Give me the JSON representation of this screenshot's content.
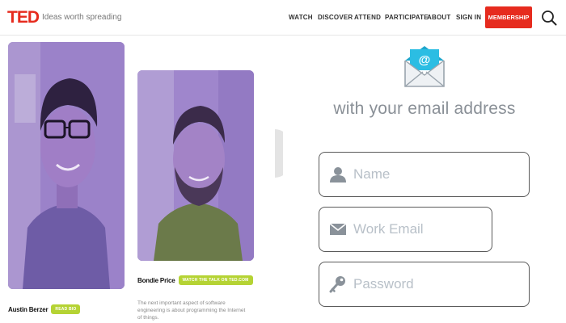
{
  "header": {
    "logo": "TED",
    "tagline": "Ideas worth spreading",
    "nav": [
      "WATCH",
      "DISCOVER",
      "ATTEND",
      "PARTICIPATE",
      "ABOUT",
      "SIGN IN"
    ],
    "membership_label": "MEMBERSHIP",
    "brand_color": "#e62b1e"
  },
  "speakers": [
    {
      "name": "Austin Berzer",
      "badge": "READ BIO"
    },
    {
      "name": "Bondie Price",
      "badge": "WATCH THE TALK ON TED.COM",
      "description": "The next important aspect of software engineering is about programming the Internet of things."
    }
  ],
  "signup": {
    "headline": "with your email address",
    "name_placeholder": "Name",
    "email_placeholder": "Work Email",
    "password_placeholder": "Password",
    "accent_color": "#22b7dc"
  },
  "icons": [
    "search-icon",
    "envelope-icon",
    "user-icon",
    "mail-icon",
    "key-icon"
  ]
}
